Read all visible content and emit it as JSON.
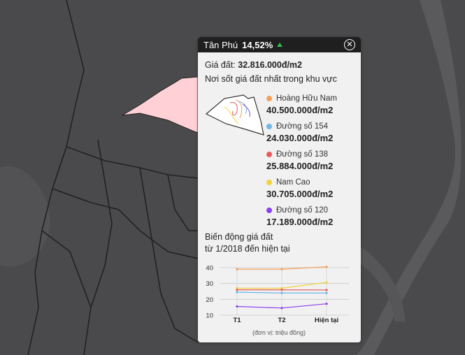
{
  "popup": {
    "district": "Tân Phú",
    "change_pct": "14,52%",
    "close_icon": "close-icon",
    "trend_icon": "arrow-up-icon",
    "trend_color": "#2fbf4a",
    "price_label": "Giá đất:",
    "price_value": "32.816.000đ/m2",
    "subtitle": "Nơi sốt giá đất nhất trong khu vực",
    "streets": [
      {
        "name": "Hoàng Hữu Nam",
        "price": "40.500.000đ/m2",
        "color": "#f5a05a"
      },
      {
        "name": "Đường số 154",
        "price": "24.030.000đ/m2",
        "color": "#6fb7e8"
      },
      {
        "name": "Đường số 138",
        "price": "25.884.000đ/m2",
        "color": "#e85c5c"
      },
      {
        "name": "Nam Cao",
        "price": "30.705.000đ/m2",
        "color": "#f3d23a"
      },
      {
        "name": "Đường số 120",
        "price": "17.189.000đ/m2",
        "color": "#8a3ff0"
      }
    ],
    "chart_title_line1": "Biến động giá đất",
    "chart_title_line2": "từ 1/2018 đến hiện tại",
    "unit_note": "(đơn vị: triệu đồng)"
  },
  "map": {
    "highlight_color": "#ffd1d6",
    "background_color": "#4a4a4c",
    "boundary_color": "#222222"
  },
  "chart_data": {
    "type": "line",
    "categories": [
      "T1",
      "T2",
      "Hiện tại"
    ],
    "ylim": [
      10,
      40
    ],
    "yticks": [
      10,
      20,
      30,
      40
    ],
    "series": [
      {
        "name": "Hoàng Hữu Nam",
        "color": "#f5a05a",
        "values": [
          39,
          39,
          40.5
        ]
      },
      {
        "name": "Nam Cao",
        "color": "#f3d23a",
        "values": [
          27,
          27,
          30.7
        ]
      },
      {
        "name": "Đường số 138",
        "color": "#e85c5c",
        "values": [
          26,
          26,
          25.9
        ]
      },
      {
        "name": "Đường số 154",
        "color": "#6fb7e8",
        "values": [
          24.5,
          24,
          24.0
        ]
      },
      {
        "name": "Đường số 120",
        "color": "#8a3ff0",
        "values": [
          15.5,
          14.5,
          17.2
        ]
      }
    ]
  }
}
